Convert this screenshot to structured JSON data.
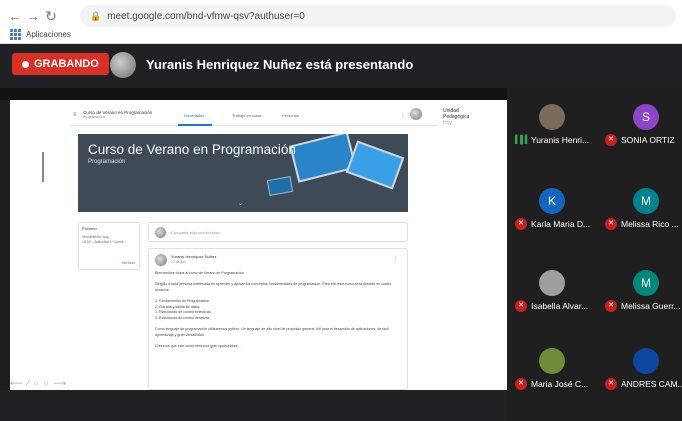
{
  "browser": {
    "url": "meet.google.com/bnd-vfmw-qsv?authuser=0",
    "bookmarks_label": "Aplicaciones"
  },
  "meet": {
    "recording_label": "GRABANDO",
    "presenting_text": "Yuranis Henriquez Nuñez está presentando"
  },
  "classroom": {
    "course_title": "Curso de Verano en Programación",
    "course_section": "Programación",
    "tabs": [
      "Novedades",
      "Trabajo en clase",
      "Personas"
    ],
    "banner_title": "Curso de Verano en Programación",
    "banner_subtitle": "Programación",
    "upcoming_title": "Próximo",
    "upcoming_text": "Vencimiento: hoy",
    "upcoming_item": "15:00 – Actividad 1: Conce…",
    "upcoming_link": "Ver todo",
    "announce_placeholder": "Comparte algo con tu clase",
    "post_author": "Yuranis Henriquez Nuñez",
    "post_date": "17 de jun.",
    "post_body": [
      "Bienvenidos todos al curso de Verano en Programación.",
      "",
      "Dirigido a toda persona interesada en aprender y aplicar los conceptos fundamentales de programación. Para ello este curso será dividido en cuatro módulos:",
      "",
      "1. Fundamentos de Programación",
      "2. Entrada y salida de datos",
      "3. Estructuras de control selectivas",
      "4. Estructuras de control iterativas",
      "",
      "Como lenguaje de programación utilizaremos python. Un lenguaje de alto nivel de propósito general, útil para el desarrollo de aplicaciones, de fácil aprendizaje y gran versatilidad.",
      "",
      "Creemos que este curso será una gran oportunidad…"
    ],
    "side_text": [
      "Unidad",
      "Pedagógica",
      "Hoy"
    ]
  },
  "participants": [
    {
      "name": "Yuranis Henri...",
      "initial": "",
      "avatar_color": "#7a6a5a",
      "state": "speaking"
    },
    {
      "name": "SONIA ORTIZ",
      "initial": "S",
      "avatar_color": "#8e44c9",
      "state": "muted"
    },
    {
      "name": "Karla Maria D...",
      "initial": "K",
      "avatar_color": "#1565c0",
      "state": "muted"
    },
    {
      "name": "Melissa Rico ...",
      "initial": "M",
      "avatar_color": "#00838f",
      "state": "muted"
    },
    {
      "name": "Isabella Alvar...",
      "initial": "",
      "avatar_color": "#9e9e9e",
      "state": "muted"
    },
    {
      "name": "Melissa Guerr...",
      "initial": "M",
      "avatar_color": "#00897b",
      "state": "muted"
    },
    {
      "name": "Maria José C...",
      "initial": "",
      "avatar_color": "#6d8b3a",
      "state": "muted"
    },
    {
      "name": "ANDRES CAM...",
      "initial": "",
      "avatar_color": "#0d47a1",
      "state": "muted"
    }
  ],
  "icons": {
    "back": "back-arrow-icon",
    "forward": "forward-arrow-icon",
    "reload": "reload-icon",
    "mic_off": "mic-off-icon",
    "speaking": "speaking-icon"
  }
}
